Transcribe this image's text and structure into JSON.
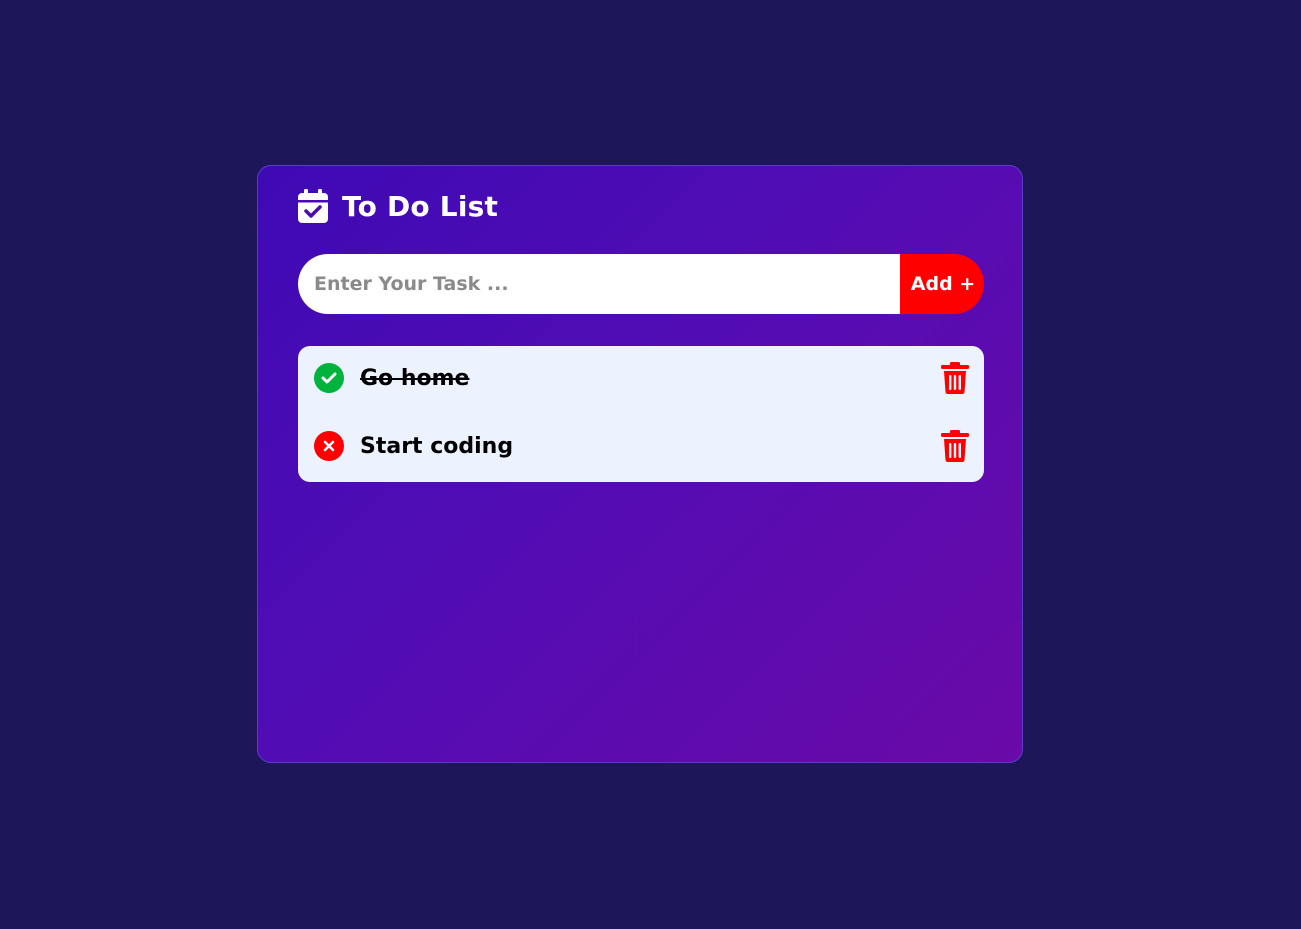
{
  "app": {
    "title": "To Do List",
    "icon": "calendar-check-icon"
  },
  "input": {
    "placeholder": "Enter Your Task ...",
    "value": ""
  },
  "add_button": {
    "label": "Add +"
  },
  "tasks": [
    {
      "text": "Go home",
      "completed": true,
      "status_icon": "check-circle-icon",
      "delete_icon": "trash-icon"
    },
    {
      "text": "Start coding",
      "completed": false,
      "status_icon": "x-circle-icon",
      "delete_icon": "trash-icon"
    }
  ],
  "colors": {
    "page_background": "#1d175a",
    "card_gradient_start": "#3e0ab4",
    "card_gradient_end": "#6a0aa8",
    "accent_red": "#ff0000",
    "done_green": "#00b33c",
    "list_background": "#edf3fe"
  }
}
